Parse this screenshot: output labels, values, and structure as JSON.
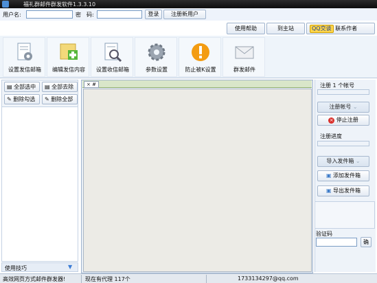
{
  "window": {
    "title": "福礼群邮件群发软件1.3.3.10"
  },
  "login": {
    "username_label": "用户名:",
    "username_value": "",
    "password_label": "密　码:",
    "password_value": "",
    "login_button": "登录",
    "register_button": "注册新用户"
  },
  "top_links": {
    "help_button": "使用帮助",
    "home_button": "到主站",
    "qq_button": "QQ交谈",
    "contact_label": "联系作者"
  },
  "toolbar": {
    "items": [
      {
        "label": "设置发信邮箱",
        "icon": "gear-document-icon"
      },
      {
        "label": "编辑发信内容",
        "icon": "edit-add-icon"
      },
      {
        "label": "设置收信邮箱",
        "icon": "search-document-icon"
      },
      {
        "label": "参数设置",
        "icon": "gear-icon"
      },
      {
        "label": "防止被K设置",
        "icon": "warning-icon"
      },
      {
        "label": "群发邮件",
        "icon": "mail-icon"
      }
    ]
  },
  "left_panel": {
    "select_all": "全部选中",
    "remove_all": "全部去除",
    "delete_checked": "删除勾选",
    "delete_all": "删除全部",
    "tip_label": "使用技巧"
  },
  "editor": {
    "tab_label": "#"
  },
  "right_panel": {
    "registered_label": "注册 1 个帐号",
    "register_account_button": "注册帐号",
    "stop_register_button": "停止注册",
    "progress_label": "注册进度",
    "import_outbox_button": "导入发件箱",
    "add_outbox_button": "添加发件箱",
    "export_outbox_button": "导出发件箱",
    "captcha_label": "验证码",
    "captcha_value": "",
    "confirm_button": "确"
  },
  "status_bar": {
    "left": "高效网页方式邮件群发器!",
    "middle": "现在有代理 117个",
    "right": "1733134297@qq.com"
  },
  "colors": {
    "accent": "#4d8fd6",
    "warning": "#f39c12",
    "stop": "#d9302c"
  }
}
